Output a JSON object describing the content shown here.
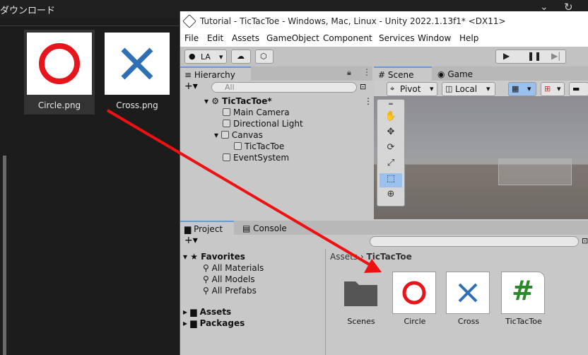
{
  "explorer": {
    "title": "ダウンロード",
    "files": [
      {
        "label": "Circle.png",
        "icon": "circle-icon"
      },
      {
        "label": "Cross.png",
        "icon": "cross-icon"
      }
    ]
  },
  "unity": {
    "title": "Tutorial - TicTacToe - Windows, Mac, Linux - Unity 2022.1.13f1* <DX11>",
    "menu": [
      "File",
      "Edit",
      "Assets",
      "GameObject",
      "Component",
      "Services",
      "Window",
      "Help"
    ],
    "toolbar": {
      "account": "LA"
    },
    "hierarchy": {
      "tab": "Hierarchy",
      "search_placeholder": "All",
      "scene_name": "TicTacToe*",
      "items": [
        "Main Camera",
        "Directional Light",
        "Canvas",
        "TicTacToe",
        "EventSystem"
      ]
    },
    "scene": {
      "tabs": [
        "Scene",
        "Game"
      ],
      "pivot": "Pivot",
      "local": "Local"
    },
    "project": {
      "tabs": [
        "Project",
        "Console"
      ],
      "favorites_label": "Favorites",
      "favorites": [
        "All Materials",
        "All Models",
        "All Prefabs"
      ],
      "roots": [
        "Assets",
        "Packages"
      ],
      "breadcrumb_root": "Assets",
      "breadcrumb_current": "TicTacToe",
      "assets": [
        "Scenes",
        "Circle",
        "Cross",
        "TicTacToe"
      ]
    }
  },
  "colors": {
    "circle": "#e8141c",
    "cross": "#2f6fb5",
    "script": "#2a8a2a",
    "arrow": "#ee1111"
  }
}
